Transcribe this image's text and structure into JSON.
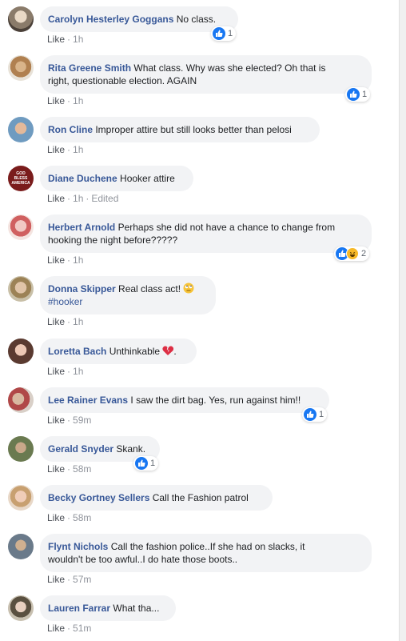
{
  "comments": [
    {
      "name": "Carolyn Hesterley Goggans",
      "text": "No class.",
      "like": "Like",
      "time": "1h",
      "reactions": "1"
    },
    {
      "name": "Rita Greene Smith",
      "text": "What class. Why was she elected? Oh that is",
      "text2": "right, questionable election. AGAIN",
      "like": "Like",
      "time": "1h",
      "reactions": "1"
    },
    {
      "name": "Ron Cline",
      "text": "Improper attire but still looks better than pelosi",
      "like": "Like",
      "time": "1h"
    },
    {
      "name": "Diane Duchene",
      "text": "Hooker attire",
      "like": "Like",
      "time": "1h",
      "edited": "Edited"
    },
    {
      "name": "Herbert Arnold",
      "text": "Perhaps she did not have a chance to change from",
      "text2": "hooking the night before?????",
      "like": "Like",
      "time": "1h",
      "reactions": "2"
    },
    {
      "name": "Donna Skipper",
      "text": "Real class act!",
      "text2": "#hooker",
      "like": "Like",
      "time": "1h"
    },
    {
      "name": "Loretta Bach",
      "text": "Unthinkable",
      "text_after": ".",
      "like": "Like",
      "time": "1h"
    },
    {
      "name": "Lee Rainer Evans",
      "text": "I saw the dirt bag. Yes, run against him!!",
      "like": "Like",
      "time": "59m",
      "reactions": "1"
    },
    {
      "name": "Gerald Snyder",
      "text": "Skank.",
      "like": "Like",
      "time": "58m",
      "reactions": "1"
    },
    {
      "name": "Becky Gortney Sellers",
      "text": "Call the Fashion patrol",
      "like": "Like",
      "time": "58m"
    },
    {
      "name": "Flynt Nichols",
      "text": "Call the fashion police..If she had on slacks, it",
      "text2": "wouldn't be too awful..I do hate those boots..",
      "like": "Like",
      "time": "57m"
    },
    {
      "name": "Lauren Farrar",
      "text": "What tha...",
      "like": "Like",
      "time": "51m"
    }
  ],
  "avatar_texts": {
    "diane": [
      "GOD",
      "BLESS",
      "AMERICA"
    ]
  },
  "colors": {
    "name": "#385898",
    "bubble": "#f2f3f5",
    "meta": "#90949c",
    "like_blue": "#1877f2"
  },
  "icons": {
    "like": "thumbs-up-icon",
    "haha": "haha-face-icon",
    "rolling_eyes": "rolling-eyes-emoji",
    "broken_heart": "broken-heart-emoji"
  }
}
